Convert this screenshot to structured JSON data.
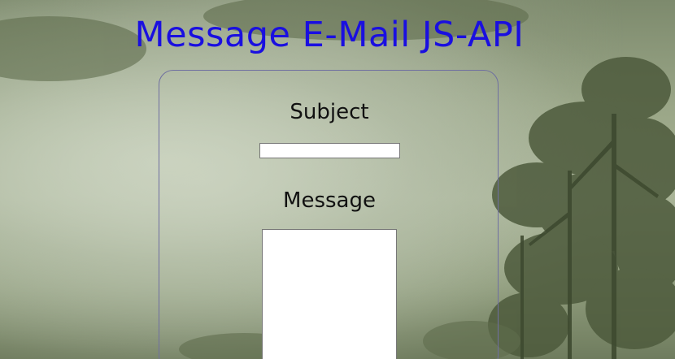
{
  "page": {
    "title": "Message E-Mail JS-API"
  },
  "form": {
    "subject_label": "Subject",
    "subject_value": "",
    "message_label": "Message",
    "message_value": ""
  },
  "colors": {
    "title": "#1a0fe0",
    "panel_border": "#6f6fa0",
    "label": "#111111"
  },
  "background": {
    "description_icon": "misty-forest-background"
  }
}
